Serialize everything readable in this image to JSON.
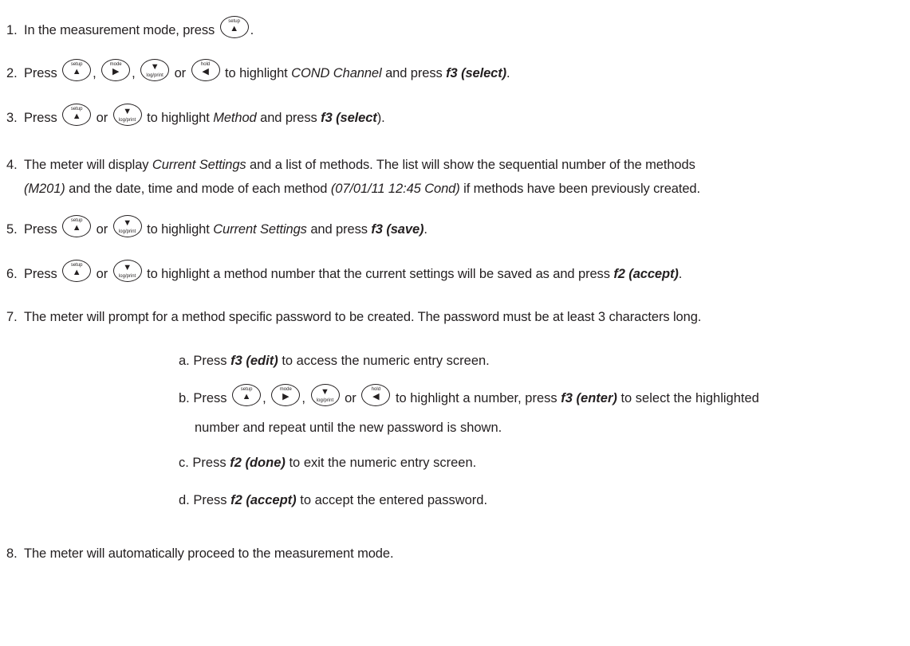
{
  "keys": {
    "setup_label": "setup",
    "mode_label": "mode",
    "logprint_label": "log/print",
    "hold_label": "hold",
    "up_glyph": "▲",
    "right_glyph": "▶",
    "down_glyph": "▼",
    "left_glyph": "◀"
  },
  "steps": {
    "s1": {
      "num": "1.",
      "t1": "In the measurement mode, press",
      "t2": "."
    },
    "s2": {
      "num": "2.",
      "t1": "Press",
      "c1": ",",
      "c2": ",",
      "or": "or",
      "t2": "to highlight",
      "i1": "COND Channel",
      "t3": "and press",
      "b1": "f3 (select)",
      "t4": "."
    },
    "s3": {
      "num": "3.",
      "t1": "Press",
      "or": "or",
      "t2": "to highlight",
      "i1": "Method",
      "t3": "and press",
      "b1": "f3 (select",
      "t4": ")."
    },
    "s4": {
      "num": "4.",
      "t1": "The meter will display",
      "i1": "Current Settings",
      "t2": "and a list of methods. The list will show the sequential number of the methods",
      "i2": "(M201)",
      "t3": "and the date, time and mode of each method",
      "b1": "(07/01/11  12:45  Cond)",
      "t4": "if methods have been previously created."
    },
    "s5": {
      "num": "5.",
      "t1": "Press",
      "or": "or",
      "t2": "to highlight",
      "i1": "Current Settings",
      "t3": "and press",
      "b1": "f3 (save)",
      "t4": "."
    },
    "s6": {
      "num": "6.",
      "t1": "Press",
      "or": "or",
      "t2": "to highlight a method number that the current settings will be saved as and press",
      "b1": "f2 (accept)",
      "t4": "."
    },
    "s7": {
      "num": "7.",
      "t1": "The meter will prompt for a method specific password to be created. The password must be at least 3 characters long."
    },
    "s7a": {
      "t1": "a. Press",
      "b1": "f3 (edit)",
      "t2": "to access the numeric entry screen."
    },
    "s7b": {
      "t1": "b. Press",
      "c1": ",",
      "c2": ",",
      "or": "or",
      "t2": "to highlight a number, press",
      "b1": "f3 (enter)",
      "t3": "to select the highlighted",
      "t4": "number and repeat until the new password is shown."
    },
    "s7c": {
      "t1": "c. Press",
      "b1": "f2 (done)",
      "t2": "to exit the numeric entry screen."
    },
    "s7d": {
      "t1": "d. Press",
      "b1": "f2 (accept)",
      "t2": "to accept the entered password."
    },
    "s8": {
      "num": "8.",
      "t1": "The meter will automatically proceed to the measurement mode."
    }
  }
}
